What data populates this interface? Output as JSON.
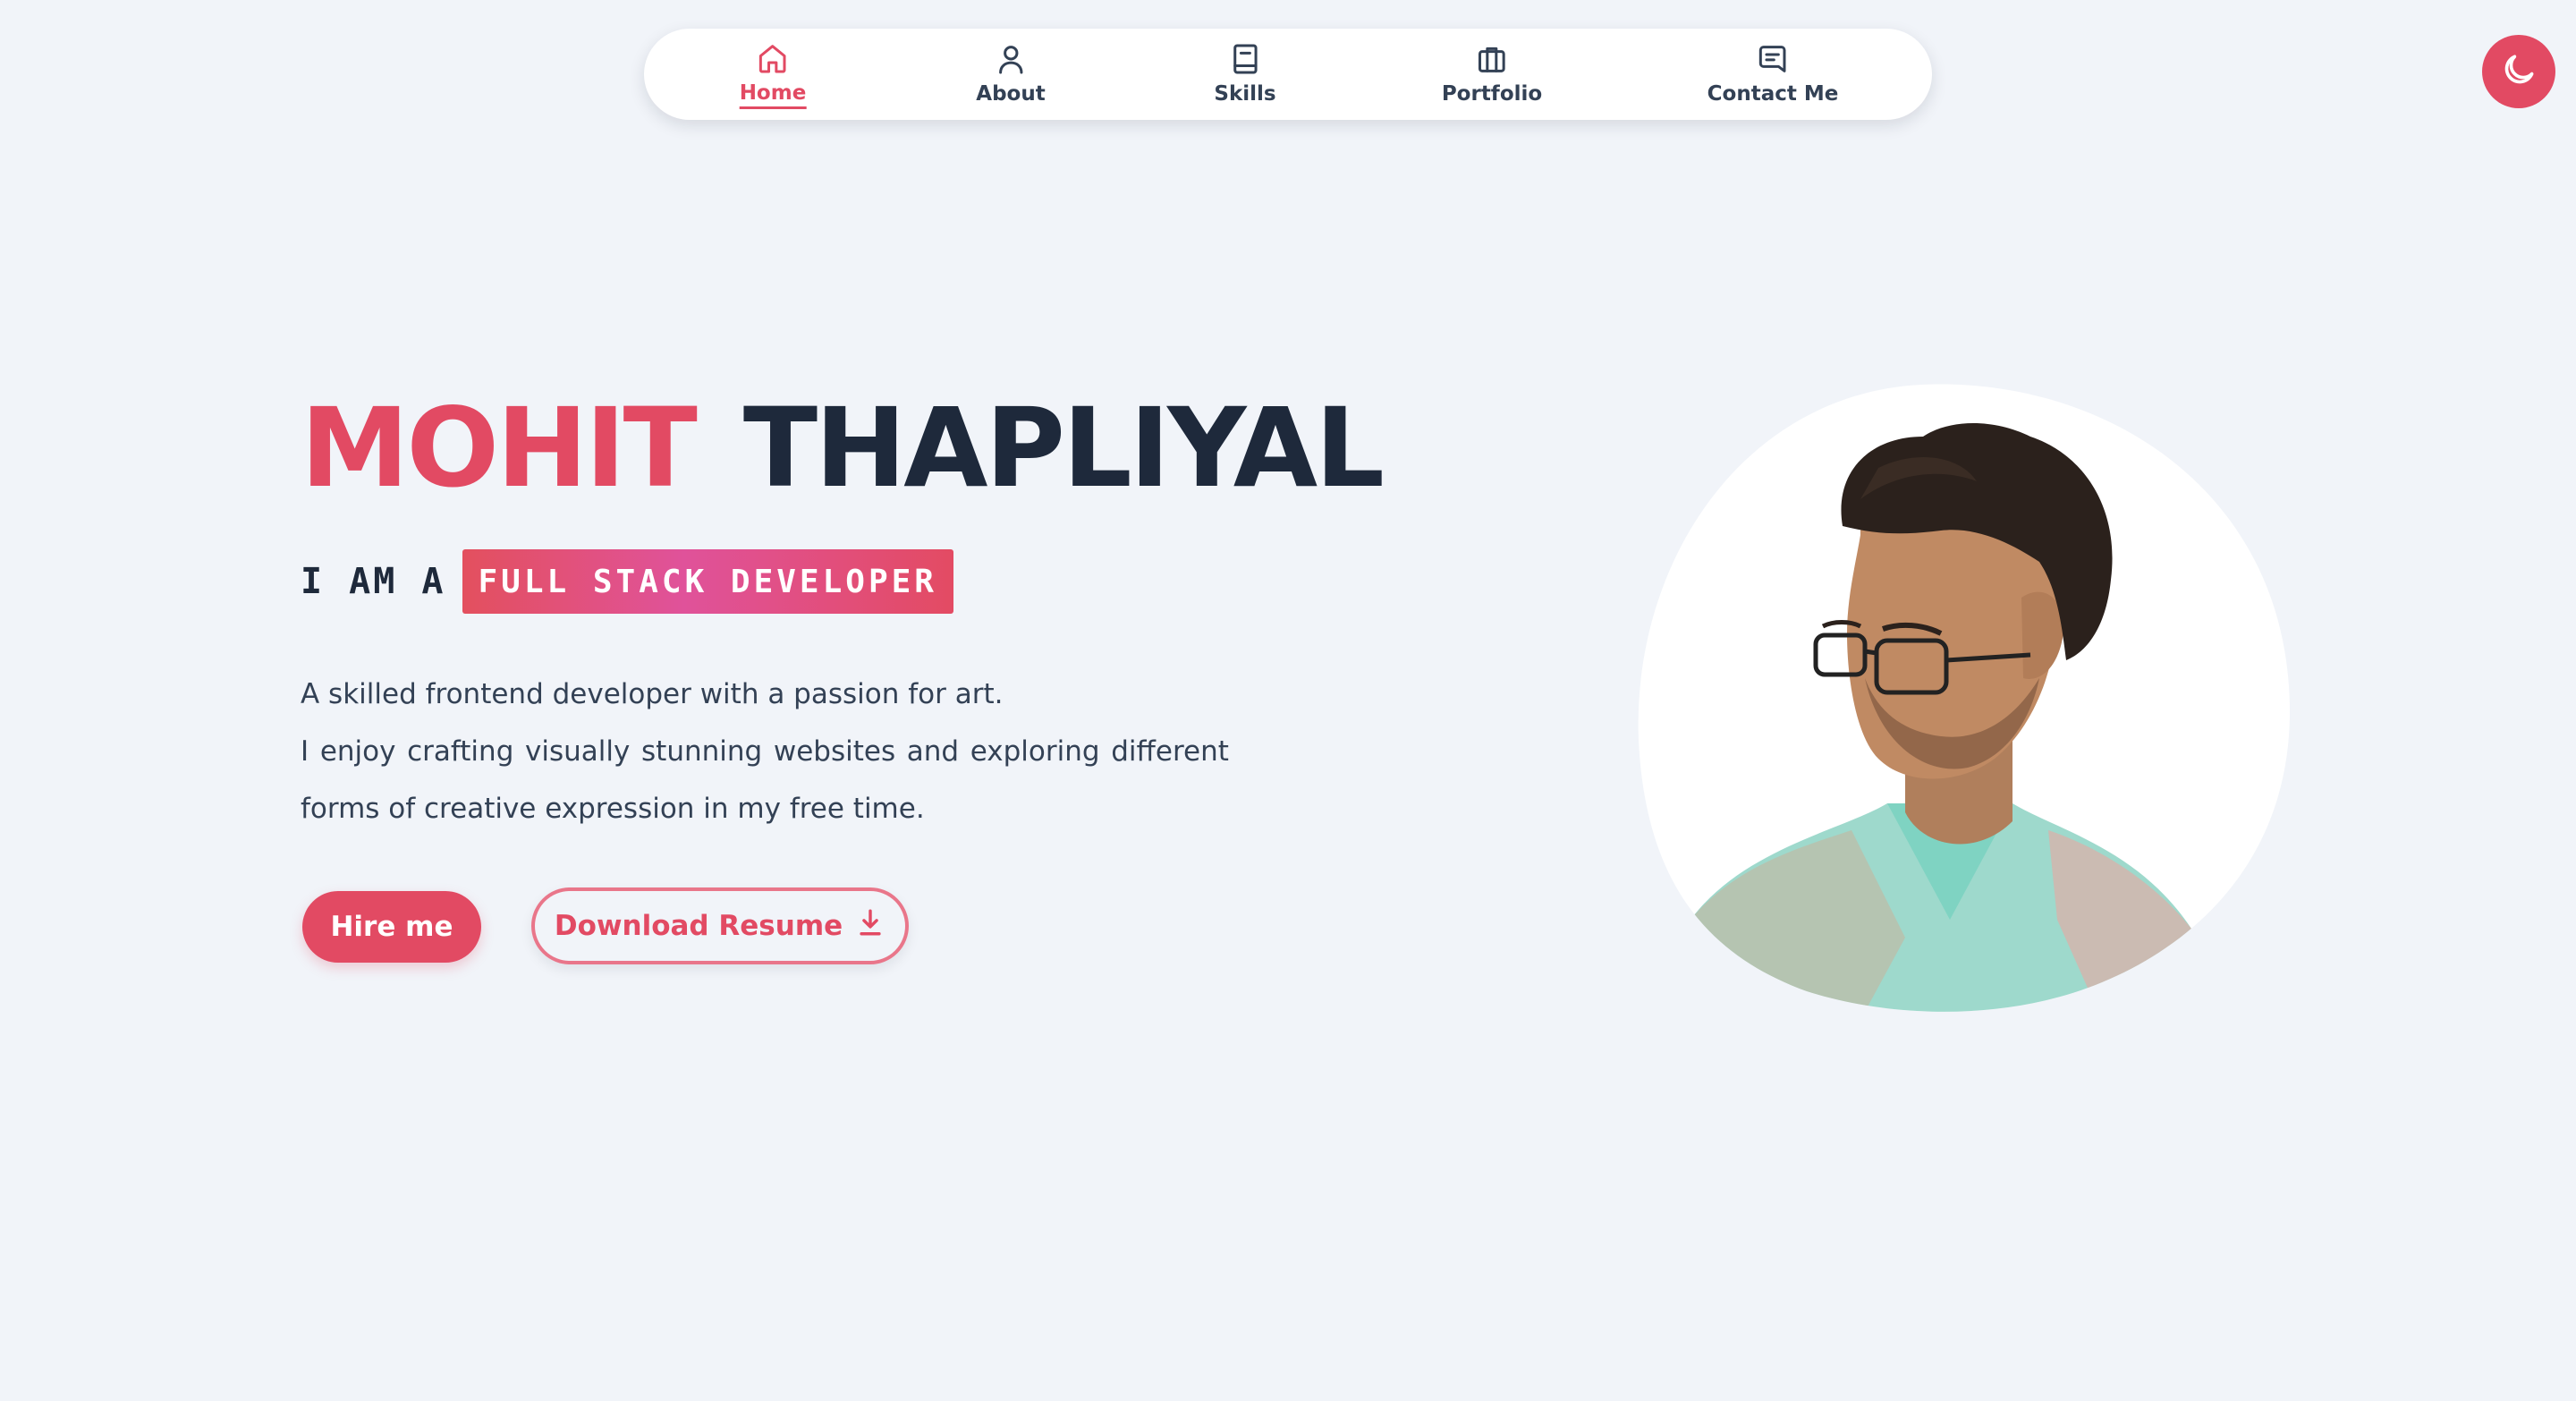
{
  "nav": {
    "items": [
      {
        "label": "Home",
        "icon": "home-icon",
        "active": true
      },
      {
        "label": "About",
        "icon": "user-icon",
        "active": false
      },
      {
        "label": "Skills",
        "icon": "book-icon",
        "active": false
      },
      {
        "label": "Portfolio",
        "icon": "briefcase-icon",
        "active": false
      },
      {
        "label": "Contact Me",
        "icon": "message-icon",
        "active": false
      }
    ]
  },
  "theme_toggle": {
    "icon": "moon-icon"
  },
  "hero": {
    "first_name": "MOHIT",
    "last_name": "THAPLIYAL",
    "role_prefix": "I AM A",
    "role": "FULL STACK DEVELOPER",
    "description": [
      "A skilled frontend developer with a passion for art.",
      "I enjoy crafting visually stunning websites and exploring different",
      "forms of creative expression in my free time."
    ],
    "hire_label": "Hire me",
    "resume_label": "Download Resume",
    "resume_icon": "download-icon"
  },
  "portrait": {
    "subject": "profile-photo"
  },
  "colors": {
    "accent": "#e24a63",
    "background": "#f1f4f9",
    "text_dark": "#1e293b"
  }
}
